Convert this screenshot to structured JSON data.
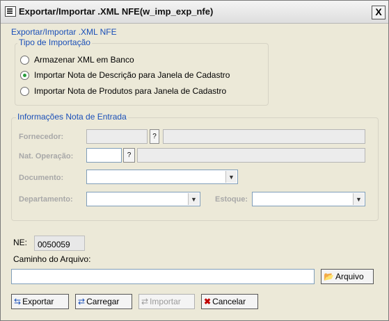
{
  "window": {
    "title": "Exportar/Importar .XML NFE(w_imp_exp_nfe)",
    "close_label": "X"
  },
  "section_title": "Exportar/Importar .XML NFE",
  "tipo": {
    "label": "Tipo de Importação",
    "options": [
      {
        "label": "Armazenar XML em Banco",
        "selected": false
      },
      {
        "label": "Importar Nota de Descrição para Janela de Cadastro",
        "selected": true
      },
      {
        "label": "Importar Nota de Produtos para Janela de Cadastro",
        "selected": false
      }
    ]
  },
  "info": {
    "label": "Informações Nota de Entrada",
    "fornecedor_label": "Fornecedor:",
    "nat_label": "Nat. Operação:",
    "documento_label": "Documento:",
    "departamento_label": "Departamento:",
    "estoque_label": "Estoque:"
  },
  "ne": {
    "label": "NE:",
    "value": "0050059"
  },
  "caminho": {
    "label": "Caminho do Arquivo:",
    "value": ""
  },
  "buttons": {
    "arquivo": "Arquivo",
    "exportar": "Exportar",
    "carregar": "Carregar",
    "importar": "Importar",
    "cancelar": "Cancelar"
  },
  "icons": {
    "app": "app-window-icon",
    "folder": "folder-icon",
    "lookup": "lookup-icon",
    "export": "export-icon",
    "load": "load-icon",
    "import": "import-icon",
    "cancel": "cancel-icon"
  },
  "colors": {
    "group_label": "#1a4fb8",
    "radio_selected": "#2a9d3a",
    "cancel_x": "#c00000"
  }
}
